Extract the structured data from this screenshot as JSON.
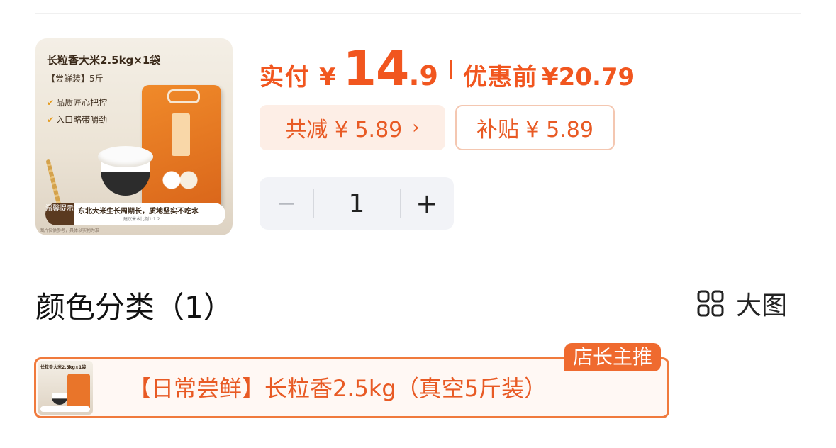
{
  "product": {
    "thumbnail": {
      "title": "长粒香大米2.5kg×1袋",
      "tag": "【尝鲜装】5斤",
      "feature_1": "品质匠心把控",
      "feature_2": "入口略带嚼劲",
      "warning_label": "温馨提示",
      "warning_text": "东北大米生长周期长，质地坚实不吃水",
      "warning_sub": "建议米水比例1:1.2",
      "footer_note": "图片仅供参考，具体以实物为准"
    }
  },
  "pricing": {
    "paid_label": "实付",
    "currency": "¥",
    "paid_integer": "14",
    "paid_dot": ".",
    "paid_decimal": "9",
    "original_label": "优惠前",
    "original_value": "¥20.79",
    "total_discount": "共减 ¥ 5.89",
    "total_discount_chevron": "›",
    "subsidy": "补贴 ¥ 5.89"
  },
  "quantity": {
    "minus": "−",
    "value": "1",
    "plus": "+"
  },
  "section": {
    "title": "颜色分类（1）",
    "big_image_label": "大图"
  },
  "variants": [
    {
      "label": "【日常尝鲜】长粒香2.5kg（真空5斤装）",
      "badge": "店长主推",
      "thumb_title": "长粒香大米2.5kg×1袋",
      "selected": true
    }
  ],
  "colors": {
    "accent": "#f1561f",
    "chip_bg": "#fdeee6",
    "stepper_bg": "#f2f3f7",
    "badge_bg": "#ef6a2f"
  },
  "icons": {
    "big_image": "grid-icon",
    "check": "check-icon"
  }
}
